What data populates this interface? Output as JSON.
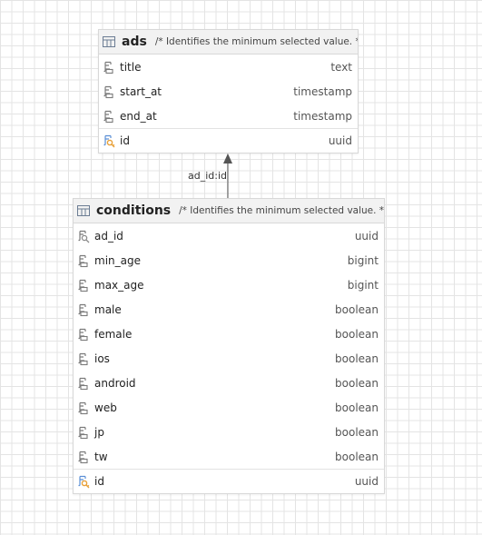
{
  "relationship": {
    "label": "ad_id:id"
  },
  "ads": {
    "name": "ads",
    "comment": "/* Identifies the minimum selected value. */",
    "columns": [
      {
        "name": "title",
        "type": "text"
      },
      {
        "name": "start_at",
        "type": "timestamp"
      },
      {
        "name": "end_at",
        "type": "timestamp"
      }
    ],
    "key": {
      "name": "id",
      "type": "uuid"
    }
  },
  "conditions": {
    "name": "conditions",
    "comment": "/* Identifies the minimum selected value. */",
    "fk": {
      "name": "ad_id",
      "type": "uuid"
    },
    "columns": [
      {
        "name": "min_age",
        "type": "bigint"
      },
      {
        "name": "max_age",
        "type": "bigint"
      },
      {
        "name": "male",
        "type": "boolean"
      },
      {
        "name": "female",
        "type": "boolean"
      },
      {
        "name": "ios",
        "type": "boolean"
      },
      {
        "name": "android",
        "type": "boolean"
      },
      {
        "name": "web",
        "type": "boolean"
      },
      {
        "name": "jp",
        "type": "boolean"
      },
      {
        "name": "tw",
        "type": "boolean"
      }
    ],
    "key": {
      "name": "id",
      "type": "uuid"
    }
  },
  "colors": {
    "grid": "#e4e4e4",
    "header_bg": "#f2f2f2",
    "border": "#d8d8d8",
    "key_accent": "#e8a13a",
    "column_icon": "#7a7a7a"
  }
}
